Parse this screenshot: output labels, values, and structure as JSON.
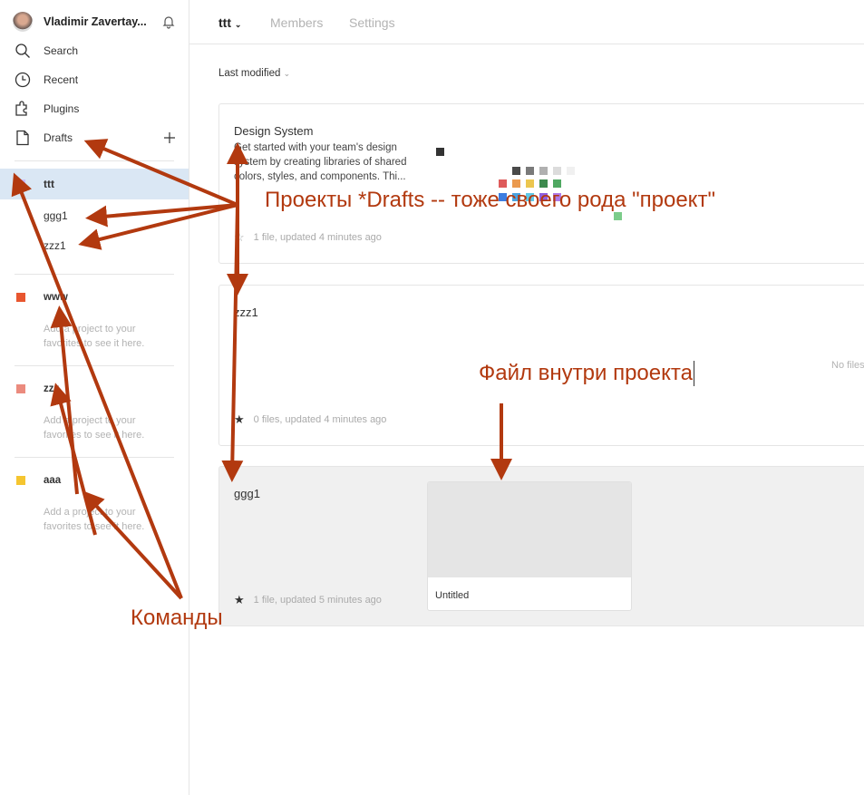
{
  "sidebar": {
    "user_name": "Vladimir Zavertay...",
    "nav": [
      {
        "label": "Search",
        "icon": "search-icon"
      },
      {
        "label": "Recent",
        "icon": "clock-icon"
      },
      {
        "label": "Plugins",
        "icon": "plugin-icon"
      },
      {
        "label": "Drafts",
        "icon": "file-icon"
      }
    ],
    "projects": [
      {
        "label": "ttt",
        "color": "#c9bdfb"
      },
      {
        "label": "ggg1"
      },
      {
        "label": "zzz1"
      }
    ],
    "teams": [
      {
        "label": "www",
        "color": "#e8562f",
        "hint": "Add a project to your favorites to see it here."
      },
      {
        "label": "zzz",
        "color": "#eb8b7e",
        "hint": "Add a project to your favorites to see it here."
      },
      {
        "label": "aaa",
        "color": "#f5c530",
        "hint": "Add a project to your favorites to see it here."
      }
    ]
  },
  "header": {
    "team": "ttt",
    "tabs": [
      "Members",
      "Settings"
    ]
  },
  "sort_label": "Last modified",
  "cards": [
    {
      "title": "Design System",
      "desc": "Get started with your team's design system by creating libraries of shared colors, styles, and components. Thi...",
      "meta": "1 file, updated 4 minutes ago",
      "starred": false
    },
    {
      "title": "zzz1",
      "meta": "0 files, updated 4 minutes ago",
      "starred": true,
      "empty": "No files"
    },
    {
      "title": "ggg1",
      "meta": "1 file, updated 5 minutes ago",
      "starred": true,
      "file": "Untitled"
    }
  ],
  "annotations": {
    "projects": "Проекты *Drafts -- тоже своего рода \"проект\"",
    "file": "Файл внутри проекта",
    "teams": "Команды",
    "color": "#b2390f"
  }
}
